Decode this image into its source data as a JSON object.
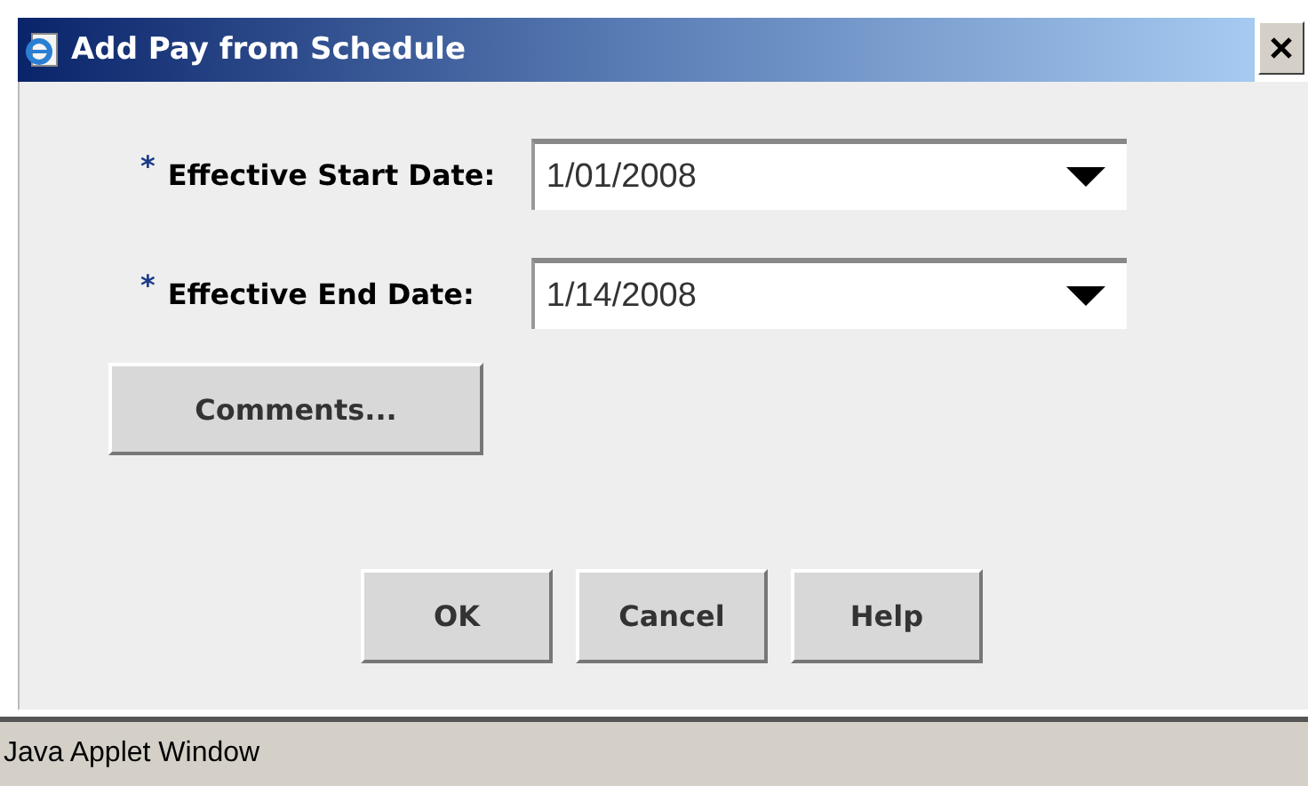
{
  "window": {
    "title": "Add Pay from Schedule"
  },
  "fields": [
    {
      "required_mark": "*",
      "label": "Effective Start Date:",
      "value": "1/01/2008"
    },
    {
      "required_mark": "*",
      "label": "Effective End Date:",
      "value": "1/14/2008"
    }
  ],
  "comments_button": "Comments...",
  "buttons": [
    "OK",
    "Cancel",
    "Help"
  ],
  "status_bar": "Java Applet Window"
}
